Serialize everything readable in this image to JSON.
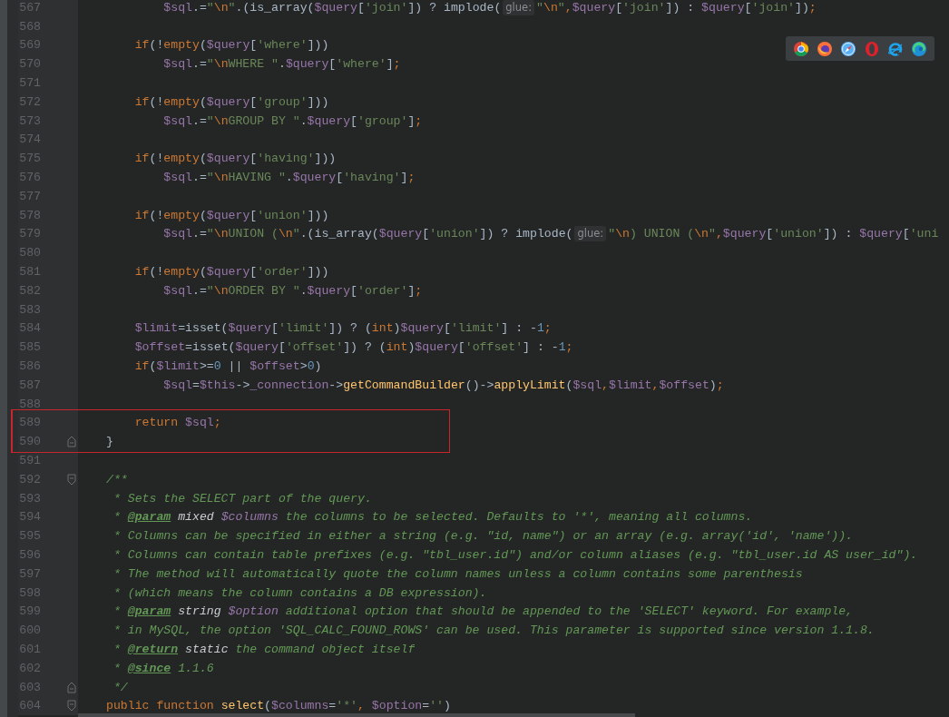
{
  "editor": {
    "lines": [
      {
        "number": "567",
        "tokens": [
          {
            "kind": "variable",
            "text": "        $sql"
          },
          {
            "kind": "plain",
            "text": ".="
          },
          {
            "kind": "string",
            "text": "\""
          },
          {
            "kind": "escape",
            "text": "\\n"
          },
          {
            "kind": "string",
            "text": "\""
          },
          {
            "kind": "plain",
            "text": ".(is_array("
          },
          {
            "kind": "variable",
            "text": "$query"
          },
          {
            "kind": "plain",
            "text": "["
          },
          {
            "kind": "string",
            "text": "'join'"
          },
          {
            "kind": "plain",
            "text": "]) ? implode("
          },
          {
            "kind": "hint",
            "text": "glue:"
          },
          {
            "kind": "string",
            "text": "\""
          },
          {
            "kind": "escape",
            "text": "\\n"
          },
          {
            "kind": "string",
            "text": "\""
          },
          {
            "kind": "keyword",
            "text": ","
          },
          {
            "kind": "variable",
            "text": "$query"
          },
          {
            "kind": "plain",
            "text": "["
          },
          {
            "kind": "string",
            "text": "'join'"
          },
          {
            "kind": "plain",
            "text": "]) : "
          },
          {
            "kind": "variable",
            "text": "$query"
          },
          {
            "kind": "plain",
            "text": "["
          },
          {
            "kind": "string",
            "text": "'join'"
          },
          {
            "kind": "plain",
            "text": "])"
          },
          {
            "kind": "keyword",
            "text": ";"
          }
        ]
      },
      {
        "number": "568"
      },
      {
        "number": "569",
        "tokens": [
          {
            "kind": "keyword",
            "text": "    if"
          },
          {
            "kind": "plain",
            "text": "(!"
          },
          {
            "kind": "keyword",
            "text": "empty"
          },
          {
            "kind": "plain",
            "text": "("
          },
          {
            "kind": "variable",
            "text": "$query"
          },
          {
            "kind": "plain",
            "text": "["
          },
          {
            "kind": "string",
            "text": "'where'"
          },
          {
            "kind": "plain",
            "text": "]))"
          }
        ]
      },
      {
        "number": "570",
        "tokens": [
          {
            "kind": "variable",
            "text": "        $sql"
          },
          {
            "kind": "plain",
            "text": ".="
          },
          {
            "kind": "string",
            "text": "\""
          },
          {
            "kind": "escape",
            "text": "\\n"
          },
          {
            "kind": "string",
            "text": "WHERE \""
          },
          {
            "kind": "plain",
            "text": "."
          },
          {
            "kind": "variable",
            "text": "$query"
          },
          {
            "kind": "plain",
            "text": "["
          },
          {
            "kind": "string",
            "text": "'where'"
          },
          {
            "kind": "plain",
            "text": "]"
          },
          {
            "kind": "keyword",
            "text": ";"
          }
        ]
      },
      {
        "number": "571"
      },
      {
        "number": "572",
        "tokens": [
          {
            "kind": "keyword",
            "text": "    if"
          },
          {
            "kind": "plain",
            "text": "(!"
          },
          {
            "kind": "keyword",
            "text": "empty"
          },
          {
            "kind": "plain",
            "text": "("
          },
          {
            "kind": "variable",
            "text": "$query"
          },
          {
            "kind": "plain",
            "text": "["
          },
          {
            "kind": "string",
            "text": "'group'"
          },
          {
            "kind": "plain",
            "text": "]))"
          }
        ]
      },
      {
        "number": "573",
        "tokens": [
          {
            "kind": "variable",
            "text": "        $sql"
          },
          {
            "kind": "plain",
            "text": ".="
          },
          {
            "kind": "string",
            "text": "\""
          },
          {
            "kind": "escape",
            "text": "\\n"
          },
          {
            "kind": "string",
            "text": "GROUP BY \""
          },
          {
            "kind": "plain",
            "text": "."
          },
          {
            "kind": "variable",
            "text": "$query"
          },
          {
            "kind": "plain",
            "text": "["
          },
          {
            "kind": "string",
            "text": "'group'"
          },
          {
            "kind": "plain",
            "text": "]"
          },
          {
            "kind": "keyword",
            "text": ";"
          }
        ]
      },
      {
        "number": "574"
      },
      {
        "number": "575",
        "tokens": [
          {
            "kind": "keyword",
            "text": "    if"
          },
          {
            "kind": "plain",
            "text": "(!"
          },
          {
            "kind": "keyword",
            "text": "empty"
          },
          {
            "kind": "plain",
            "text": "("
          },
          {
            "kind": "variable",
            "text": "$query"
          },
          {
            "kind": "plain",
            "text": "["
          },
          {
            "kind": "string",
            "text": "'having'"
          },
          {
            "kind": "plain",
            "text": "]))"
          }
        ]
      },
      {
        "number": "576",
        "tokens": [
          {
            "kind": "variable",
            "text": "        $sql"
          },
          {
            "kind": "plain",
            "text": ".="
          },
          {
            "kind": "string",
            "text": "\""
          },
          {
            "kind": "escape",
            "text": "\\n"
          },
          {
            "kind": "string",
            "text": "HAVING \""
          },
          {
            "kind": "plain",
            "text": "."
          },
          {
            "kind": "variable",
            "text": "$query"
          },
          {
            "kind": "plain",
            "text": "["
          },
          {
            "kind": "string",
            "text": "'having'"
          },
          {
            "kind": "plain",
            "text": "]"
          },
          {
            "kind": "keyword",
            "text": ";"
          }
        ]
      },
      {
        "number": "577"
      },
      {
        "number": "578",
        "tokens": [
          {
            "kind": "keyword",
            "text": "    if"
          },
          {
            "kind": "plain",
            "text": "(!"
          },
          {
            "kind": "keyword",
            "text": "empty"
          },
          {
            "kind": "plain",
            "text": "("
          },
          {
            "kind": "variable",
            "text": "$query"
          },
          {
            "kind": "plain",
            "text": "["
          },
          {
            "kind": "string",
            "text": "'union'"
          },
          {
            "kind": "plain",
            "text": "]))"
          }
        ]
      },
      {
        "number": "579",
        "tokens": [
          {
            "kind": "variable",
            "text": "        $sql"
          },
          {
            "kind": "plain",
            "text": ".="
          },
          {
            "kind": "string",
            "text": "\""
          },
          {
            "kind": "escape",
            "text": "\\n"
          },
          {
            "kind": "string",
            "text": "UNION ("
          },
          {
            "kind": "escape",
            "text": "\\n"
          },
          {
            "kind": "string",
            "text": "\""
          },
          {
            "kind": "plain",
            "text": ".(is_array("
          },
          {
            "kind": "variable",
            "text": "$query"
          },
          {
            "kind": "plain",
            "text": "["
          },
          {
            "kind": "string",
            "text": "'union'"
          },
          {
            "kind": "plain",
            "text": "]) ? implode("
          },
          {
            "kind": "hint",
            "text": "glue:"
          },
          {
            "kind": "string",
            "text": "\""
          },
          {
            "kind": "escape",
            "text": "\\n"
          },
          {
            "kind": "string",
            "text": ") UNION ("
          },
          {
            "kind": "escape",
            "text": "\\n"
          },
          {
            "kind": "string",
            "text": "\""
          },
          {
            "kind": "keyword",
            "text": ","
          },
          {
            "kind": "variable",
            "text": "$query"
          },
          {
            "kind": "plain",
            "text": "["
          },
          {
            "kind": "string",
            "text": "'union'"
          },
          {
            "kind": "plain",
            "text": "]) : "
          },
          {
            "kind": "variable",
            "text": "$query"
          },
          {
            "kind": "plain",
            "text": "["
          },
          {
            "kind": "string",
            "text": "'uni"
          }
        ]
      },
      {
        "number": "580"
      },
      {
        "number": "581",
        "tokens": [
          {
            "kind": "keyword",
            "text": "    if"
          },
          {
            "kind": "plain",
            "text": "(!"
          },
          {
            "kind": "keyword",
            "text": "empty"
          },
          {
            "kind": "plain",
            "text": "("
          },
          {
            "kind": "variable",
            "text": "$query"
          },
          {
            "kind": "plain",
            "text": "["
          },
          {
            "kind": "string",
            "text": "'order'"
          },
          {
            "kind": "plain",
            "text": "]))"
          }
        ]
      },
      {
        "number": "582",
        "tokens": [
          {
            "kind": "variable",
            "text": "        $sql"
          },
          {
            "kind": "plain",
            "text": ".="
          },
          {
            "kind": "string",
            "text": "\""
          },
          {
            "kind": "escape",
            "text": "\\n"
          },
          {
            "kind": "string",
            "text": "ORDER BY \""
          },
          {
            "kind": "plain",
            "text": "."
          },
          {
            "kind": "variable",
            "text": "$query"
          },
          {
            "kind": "plain",
            "text": "["
          },
          {
            "kind": "string",
            "text": "'order'"
          },
          {
            "kind": "plain",
            "text": "]"
          },
          {
            "kind": "keyword",
            "text": ";"
          }
        ]
      },
      {
        "number": "583"
      },
      {
        "number": "584",
        "tokens": [
          {
            "kind": "variable",
            "text": "    $limit"
          },
          {
            "kind": "plain",
            "text": "=isset("
          },
          {
            "kind": "variable",
            "text": "$query"
          },
          {
            "kind": "plain",
            "text": "["
          },
          {
            "kind": "string",
            "text": "'limit'"
          },
          {
            "kind": "plain",
            "text": "]) ? ("
          },
          {
            "kind": "keyword",
            "text": "int"
          },
          {
            "kind": "plain",
            "text": ")"
          },
          {
            "kind": "variable",
            "text": "$query"
          },
          {
            "kind": "plain",
            "text": "["
          },
          {
            "kind": "string",
            "text": "'limit'"
          },
          {
            "kind": "plain",
            "text": "] : -"
          },
          {
            "kind": "number",
            "text": "1"
          },
          {
            "kind": "keyword",
            "text": ";"
          }
        ]
      },
      {
        "number": "585",
        "tokens": [
          {
            "kind": "variable",
            "text": "    $offset"
          },
          {
            "kind": "plain",
            "text": "=isset("
          },
          {
            "kind": "variable",
            "text": "$query"
          },
          {
            "kind": "plain",
            "text": "["
          },
          {
            "kind": "string",
            "text": "'offset'"
          },
          {
            "kind": "plain",
            "text": "]) ? ("
          },
          {
            "kind": "keyword",
            "text": "int"
          },
          {
            "kind": "plain",
            "text": ")"
          },
          {
            "kind": "variable",
            "text": "$query"
          },
          {
            "kind": "plain",
            "text": "["
          },
          {
            "kind": "string",
            "text": "'offset'"
          },
          {
            "kind": "plain",
            "text": "] : -"
          },
          {
            "kind": "number",
            "text": "1"
          },
          {
            "kind": "keyword",
            "text": ";"
          }
        ]
      },
      {
        "number": "586",
        "tokens": [
          {
            "kind": "keyword",
            "text": "    if"
          },
          {
            "kind": "plain",
            "text": "("
          },
          {
            "kind": "variable",
            "text": "$limit"
          },
          {
            "kind": "plain",
            "text": ">="
          },
          {
            "kind": "number",
            "text": "0"
          },
          {
            "kind": "plain",
            "text": " || "
          },
          {
            "kind": "variable",
            "text": "$offset"
          },
          {
            "kind": "plain",
            "text": ">"
          },
          {
            "kind": "number",
            "text": "0"
          },
          {
            "kind": "plain",
            "text": ")"
          }
        ]
      },
      {
        "number": "587",
        "tokens": [
          {
            "kind": "variable",
            "text": "        $sql"
          },
          {
            "kind": "plain",
            "text": "="
          },
          {
            "kind": "variable",
            "text": "$this"
          },
          {
            "kind": "plain",
            "text": "->"
          },
          {
            "kind": "variable",
            "text": "_connection"
          },
          {
            "kind": "plain",
            "text": "->"
          },
          {
            "kind": "function",
            "text": "getCommandBuilder"
          },
          {
            "kind": "plain",
            "text": "()->"
          },
          {
            "kind": "function",
            "text": "applyLimit"
          },
          {
            "kind": "plain",
            "text": "("
          },
          {
            "kind": "variable",
            "text": "$sql"
          },
          {
            "kind": "keyword",
            "text": ","
          },
          {
            "kind": "variable",
            "text": "$limit"
          },
          {
            "kind": "keyword",
            "text": ","
          },
          {
            "kind": "variable",
            "text": "$offset"
          },
          {
            "kind": "plain",
            "text": ")"
          },
          {
            "kind": "keyword",
            "text": ";"
          }
        ]
      },
      {
        "number": "588"
      },
      {
        "number": "589",
        "tokens": [
          {
            "kind": "keyword",
            "text": "    return "
          },
          {
            "kind": "variable",
            "text": "$sql"
          },
          {
            "kind": "keyword",
            "text": ";"
          }
        ]
      },
      {
        "number": "590",
        "fold_end": true,
        "tokens": [
          {
            "kind": "plain",
            "text": "}"
          }
        ]
      },
      {
        "number": "591"
      },
      {
        "number": "592",
        "fold_start": true,
        "tokens": [
          {
            "kind": "doc",
            "text": "/**"
          }
        ]
      },
      {
        "number": "593",
        "tokens": [
          {
            "kind": "doc",
            "text": " * Sets the SELECT part of the query."
          }
        ]
      },
      {
        "number": "594",
        "tokens": [
          {
            "kind": "doc",
            "text": " * "
          },
          {
            "kind": "doctag",
            "text": "@param"
          },
          {
            "kind": "doctype",
            "text": " mixed"
          },
          {
            "kind": "docvar",
            "text": " $columns"
          },
          {
            "kind": "doc",
            "text": " the columns to be selected. Defaults to '*', meaning all columns."
          }
        ]
      },
      {
        "number": "595",
        "tokens": [
          {
            "kind": "doc",
            "text": " * Columns can be specified in either a string (e.g. \"id, name\") or an array (e.g. array('id', 'name'))."
          }
        ]
      },
      {
        "number": "596",
        "tokens": [
          {
            "kind": "doc",
            "text": " * Columns can contain table prefixes (e.g. \"tbl_user.id\") and/or column aliases (e.g. \"tbl_user.id AS user_id\")."
          }
        ]
      },
      {
        "number": "597",
        "tokens": [
          {
            "kind": "doc",
            "text": " * The method will automatically quote the column names unless a column contains some parenthesis"
          }
        ]
      },
      {
        "number": "598",
        "tokens": [
          {
            "kind": "doc",
            "text": " * (which means the column contains a DB expression)."
          }
        ]
      },
      {
        "number": "599",
        "tokens": [
          {
            "kind": "doc",
            "text": " * "
          },
          {
            "kind": "doctag",
            "text": "@param"
          },
          {
            "kind": "doctype",
            "text": " string"
          },
          {
            "kind": "docvar",
            "text": " $option"
          },
          {
            "kind": "doc",
            "text": " additional option that should be appended to the 'SELECT' keyword. For example,"
          }
        ]
      },
      {
        "number": "600",
        "tokens": [
          {
            "kind": "doc",
            "text": " * in MySQL, the option 'SQL_CALC_FOUND_ROWS' can be used. This parameter is supported since version 1.1.8."
          }
        ]
      },
      {
        "number": "601",
        "tokens": [
          {
            "kind": "doc",
            "text": " * "
          },
          {
            "kind": "doctag",
            "text": "@return"
          },
          {
            "kind": "doctype",
            "text": " static"
          },
          {
            "kind": "doc",
            "text": " the command object itself"
          }
        ]
      },
      {
        "number": "602",
        "tokens": [
          {
            "kind": "doc",
            "text": " * "
          },
          {
            "kind": "doctag",
            "text": "@since"
          },
          {
            "kind": "doc",
            "text": " 1.1.6"
          }
        ]
      },
      {
        "number": "603",
        "fold_end": true,
        "tokens": [
          {
            "kind": "doc",
            "text": " */"
          }
        ]
      },
      {
        "number": "604",
        "fold_start": true,
        "tokens": [
          {
            "kind": "keyword",
            "text": "public function "
          },
          {
            "kind": "function",
            "text": "select"
          },
          {
            "kind": "plain",
            "text": "("
          },
          {
            "kind": "variable",
            "text": "$columns"
          },
          {
            "kind": "plain",
            "text": "="
          },
          {
            "kind": "string",
            "text": "'*'"
          },
          {
            "kind": "keyword",
            "text": ","
          },
          {
            "kind": "variable",
            "text": " $option"
          },
          {
            "kind": "plain",
            "text": "="
          },
          {
            "kind": "string",
            "text": "''"
          },
          {
            "kind": "plain",
            "text": ")"
          }
        ]
      }
    ]
  },
  "browser_toolbar": {
    "buttons": [
      {
        "kind": "ring"
      },
      {
        "kind": "fox"
      },
      {
        "kind": "compass"
      },
      {
        "kind": "oval"
      },
      {
        "kind": "swoosh"
      },
      {
        "kind": "wave"
      }
    ]
  }
}
